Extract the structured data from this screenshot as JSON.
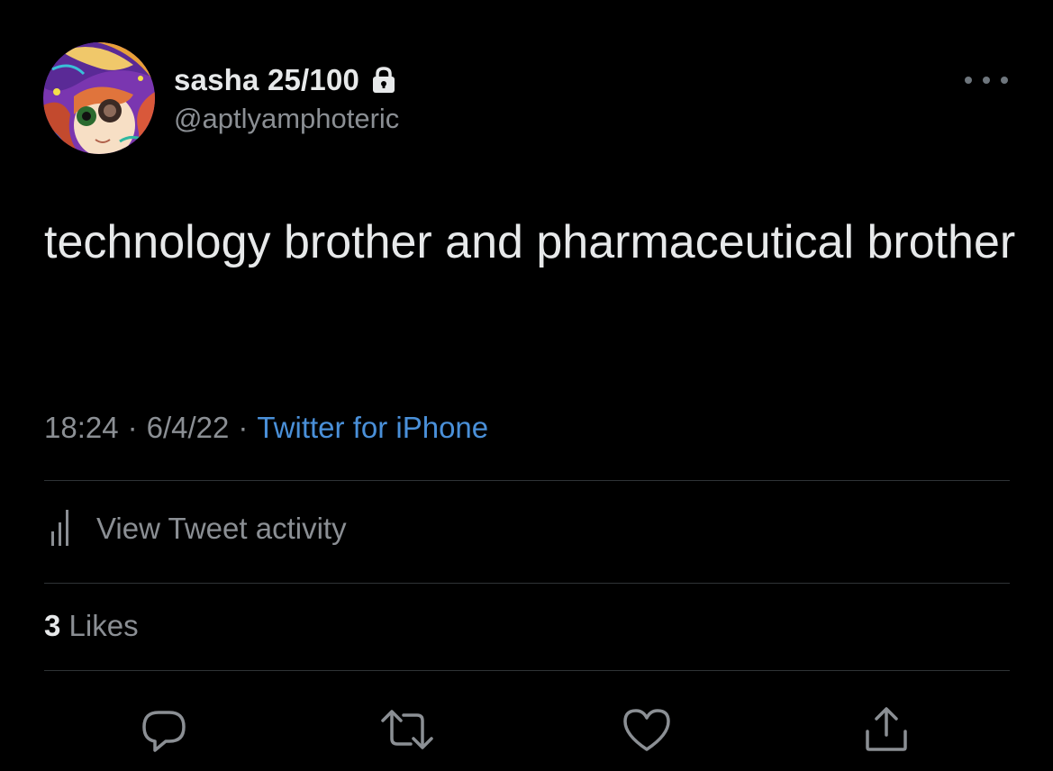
{
  "tweet": {
    "author": {
      "display_name": "sasha 25/100",
      "handle": "@aptlyamphoteric",
      "protected_icon": "lock-icon",
      "avatar": "illustrated-avatar"
    },
    "more_icon": "more-horizontal-icon",
    "text": "technology brother and pharmaceutical brother",
    "time": "18:24",
    "date": "6/4/22",
    "separator": "·",
    "source": "Twitter for iPhone",
    "activity": {
      "icon": "analytics-bars-icon",
      "label": "View Tweet activity"
    },
    "likes": {
      "count": "3",
      "label": "Likes"
    },
    "actions": [
      {
        "name": "reply",
        "icon": "reply-bubble-icon"
      },
      {
        "name": "retweet",
        "icon": "retweet-arrows-icon"
      },
      {
        "name": "like",
        "icon": "heart-icon"
      },
      {
        "name": "share",
        "icon": "share-upload-icon"
      }
    ]
  },
  "colors": {
    "background": "#000000",
    "primary_text": "#e7e9ea",
    "secondary_text": "#8b8f94",
    "link": "#4a90d9",
    "divider": "#2f3336",
    "icon": "#8b8f94"
  }
}
